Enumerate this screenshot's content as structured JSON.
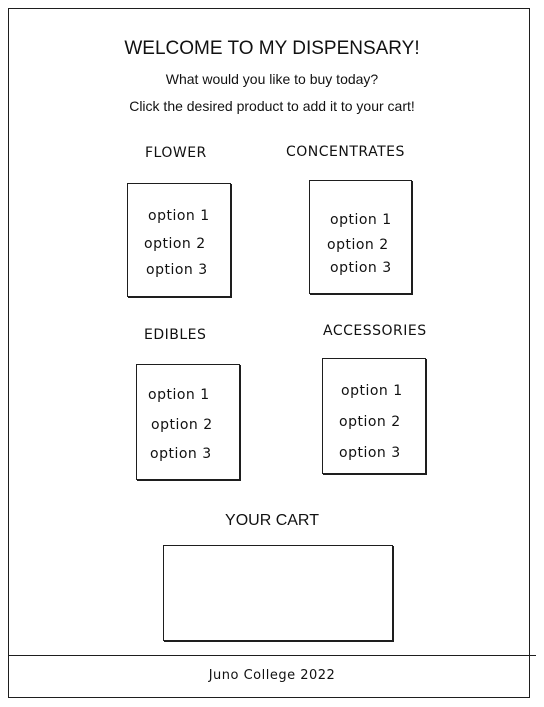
{
  "header": {
    "title": "WELCOME TO MY DISPENSARY!",
    "subtitle": "What would you like to buy today?",
    "instruction": "Click the desired product to add it to your cart!"
  },
  "categories": [
    {
      "label": "FLOWER",
      "options": [
        "option 1",
        "option 2",
        "option 3"
      ]
    },
    {
      "label": "CONCENTRATES",
      "options": [
        "option 1",
        "option 2",
        "option 3"
      ]
    },
    {
      "label": "EDIBLES",
      "options": [
        "option 1",
        "option 2",
        "option 3"
      ]
    },
    {
      "label": "ACCESSORIES",
      "options": [
        "option 1",
        "option 2",
        "option 3"
      ]
    }
  ],
  "cart": {
    "title": "YOUR CART"
  },
  "footer": {
    "text": "Juno College 2022"
  }
}
